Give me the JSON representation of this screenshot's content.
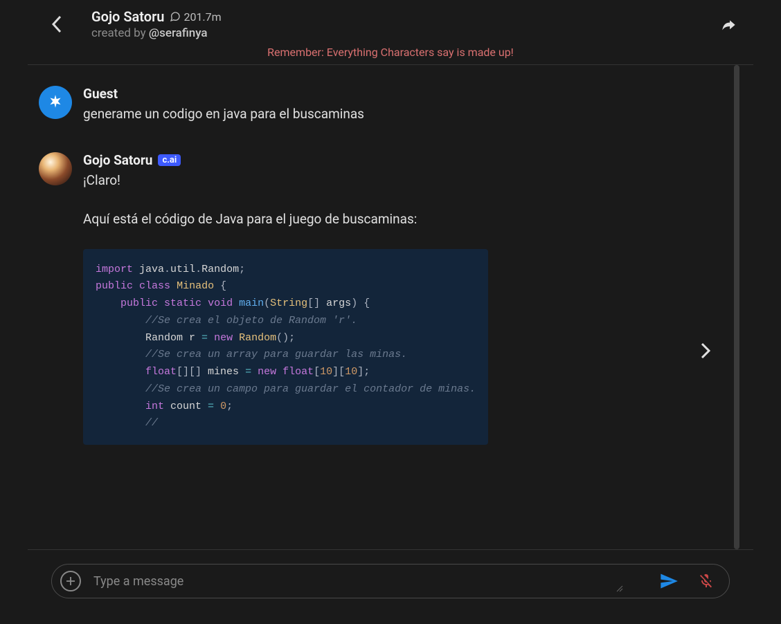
{
  "header": {
    "character_name": "Gojo Satoru",
    "chat_count": "201.7m",
    "created_by_label": "created by ",
    "creator_handle": "@serafinya"
  },
  "warning": "Remember: Everything Characters say is made up!",
  "messages": [
    {
      "author": "Guest",
      "is_character": false,
      "text": "generame un codigo en java para el buscaminas"
    },
    {
      "author": "Gojo Satoru",
      "is_character": true,
      "badge": "c.ai",
      "paragraphs": [
        "¡Claro!",
        "Aquí está el código de Java para el juego de buscaminas:"
      ],
      "code": {
        "tokens": [
          {
            "t": "kw",
            "v": "import"
          },
          {
            "t": "id",
            "v": " java"
          },
          {
            "t": "pun",
            "v": "."
          },
          {
            "t": "id",
            "v": "util"
          },
          {
            "t": "pun",
            "v": "."
          },
          {
            "t": "id",
            "v": "Random"
          },
          {
            "t": "pun",
            "v": ";"
          },
          {
            "t": "nl"
          },
          {
            "t": "kw",
            "v": "public"
          },
          {
            "t": "id",
            "v": " "
          },
          {
            "t": "kw",
            "v": "class"
          },
          {
            "t": "id",
            "v": " "
          },
          {
            "t": "cls",
            "v": "Minado"
          },
          {
            "t": "id",
            "v": " "
          },
          {
            "t": "pun",
            "v": "{"
          },
          {
            "t": "nl"
          },
          {
            "t": "id",
            "v": "    "
          },
          {
            "t": "kw",
            "v": "public"
          },
          {
            "t": "id",
            "v": " "
          },
          {
            "t": "kw",
            "v": "static"
          },
          {
            "t": "id",
            "v": " "
          },
          {
            "t": "kw",
            "v": "void"
          },
          {
            "t": "id",
            "v": " "
          },
          {
            "t": "fn",
            "v": "main"
          },
          {
            "t": "pun",
            "v": "("
          },
          {
            "t": "cls",
            "v": "String"
          },
          {
            "t": "pun",
            "v": "[]"
          },
          {
            "t": "id",
            "v": " args"
          },
          {
            "t": "pun",
            "v": ")"
          },
          {
            "t": "id",
            "v": " "
          },
          {
            "t": "pun",
            "v": "{"
          },
          {
            "t": "nl"
          },
          {
            "t": "id",
            "v": "        "
          },
          {
            "t": "cmt",
            "v": "//Se crea el objeto de Random 'r'."
          },
          {
            "t": "nl"
          },
          {
            "t": "id",
            "v": "        Random r "
          },
          {
            "t": "op",
            "v": "="
          },
          {
            "t": "id",
            "v": " "
          },
          {
            "t": "kw",
            "v": "new"
          },
          {
            "t": "id",
            "v": " "
          },
          {
            "t": "cls",
            "v": "Random"
          },
          {
            "t": "pun",
            "v": "();"
          },
          {
            "t": "nl"
          },
          {
            "t": "id",
            "v": "        "
          },
          {
            "t": "cmt",
            "v": "//Se crea un array para guardar las minas."
          },
          {
            "t": "nl"
          },
          {
            "t": "id",
            "v": "        "
          },
          {
            "t": "kw",
            "v": "float"
          },
          {
            "t": "pun",
            "v": "[][]"
          },
          {
            "t": "id",
            "v": " mines "
          },
          {
            "t": "op",
            "v": "="
          },
          {
            "t": "id",
            "v": " "
          },
          {
            "t": "kw",
            "v": "new"
          },
          {
            "t": "id",
            "v": " "
          },
          {
            "t": "kw",
            "v": "float"
          },
          {
            "t": "pun",
            "v": "["
          },
          {
            "t": "num",
            "v": "10"
          },
          {
            "t": "pun",
            "v": "]["
          },
          {
            "t": "num",
            "v": "10"
          },
          {
            "t": "pun",
            "v": "];"
          },
          {
            "t": "nl"
          },
          {
            "t": "id",
            "v": "        "
          },
          {
            "t": "cmt",
            "v": "//Se crea un campo para guardar el contador de minas."
          },
          {
            "t": "nl"
          },
          {
            "t": "id",
            "v": "        "
          },
          {
            "t": "kw",
            "v": "int"
          },
          {
            "t": "id",
            "v": " count "
          },
          {
            "t": "op",
            "v": "="
          },
          {
            "t": "id",
            "v": " "
          },
          {
            "t": "num",
            "v": "0"
          },
          {
            "t": "pun",
            "v": ";"
          },
          {
            "t": "nl"
          },
          {
            "t": "id",
            "v": "        "
          },
          {
            "t": "cmt",
            "v": "//"
          }
        ]
      }
    }
  ],
  "composer": {
    "placeholder": "Type a message"
  },
  "icons": {
    "back": "back-icon",
    "share": "share-icon",
    "chat_bubble": "chat-bubble-icon",
    "star": "star-icon",
    "chevron_right": "chevron-right-icon",
    "plus": "plus-icon",
    "send": "send-icon",
    "mic_off": "mic-off-icon",
    "resize": "resize-icon"
  }
}
